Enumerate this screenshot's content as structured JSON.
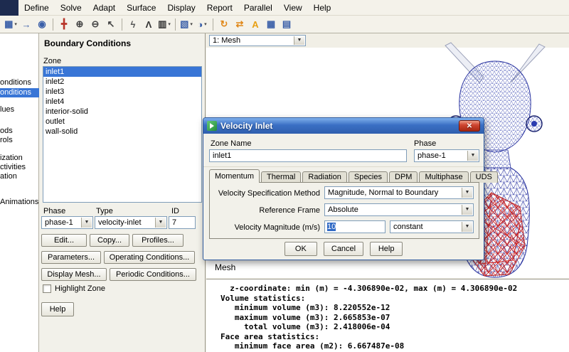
{
  "colors": {
    "selection_blue": "#3875d6",
    "titlebar_blue": "#3a6fc4",
    "close_button_red": "#cf4631",
    "mesh_blue": "#2a34a0",
    "mesh_red": "#cc2222"
  },
  "menubar": {
    "items": [
      "Define",
      "Solve",
      "Adapt",
      "Surface",
      "Display",
      "Report",
      "Parallel",
      "View",
      "Help"
    ]
  },
  "toolbar": {
    "icons": [
      {
        "name": "save-icon",
        "glyph": "▦",
        "color": "#3a5fa8"
      },
      {
        "name": "export-icon",
        "glyph": "→",
        "color": "#3a5fa8"
      },
      {
        "name": "snapshot-icon",
        "glyph": "◉",
        "color": "#3a5fa8"
      },
      {
        "name": "pan-icon",
        "glyph": "╋",
        "color": "#b8352a"
      },
      {
        "name": "zoom-in-icon",
        "glyph": "⊕",
        "color": "#444444"
      },
      {
        "name": "zoom-out-icon",
        "glyph": "⊖",
        "color": "#444444"
      },
      {
        "name": "pick-icon",
        "glyph": "↖",
        "color": "#444444"
      },
      {
        "name": "probe-icon",
        "glyph": "ϟ",
        "color": "#555555"
      },
      {
        "name": "profile-icon",
        "glyph": "Λ",
        "color": "#333333"
      },
      {
        "name": "ruler-icon",
        "glyph": "▥",
        "color": "#333333"
      },
      {
        "name": "scene-icon",
        "glyph": "▧",
        "color": "#3a5fa8"
      },
      {
        "name": "lights-icon",
        "glyph": "◑",
        "color": "#3a5fa8"
      },
      {
        "name": "refresh-icon",
        "glyph": "↻",
        "color": "#e0881a"
      },
      {
        "name": "sync-icon",
        "glyph": "⇄",
        "color": "#e0881a"
      },
      {
        "name": "annotate-icon",
        "glyph": "A",
        "color": "#e8a013"
      },
      {
        "name": "grid-icon",
        "glyph": "▦",
        "color": "#3a5fa8"
      },
      {
        "name": "layout-icon",
        "glyph": "▤",
        "color": "#3a5fa8"
      }
    ]
  },
  "nav_tree": {
    "items": [
      {
        "label": "onditions",
        "selected": false
      },
      {
        "label": "onditions",
        "selected": true
      },
      {
        "label": "lues",
        "selected": false
      },
      {
        "label": "ods",
        "selected": false
      },
      {
        "label": "rols",
        "selected": false
      },
      {
        "label": "ization",
        "selected": false
      },
      {
        "label": "ctivities",
        "selected": false
      },
      {
        "label": "ation",
        "selected": false
      },
      {
        "label": "Animations",
        "selected": false
      }
    ]
  },
  "bc_panel": {
    "title": "Boundary Conditions",
    "zone_label": "Zone",
    "zones": [
      "inlet1",
      "inlet2",
      "inlet3",
      "inlet4",
      "interior-solid",
      "outlet",
      "wall-solid"
    ],
    "selected_zone": "inlet1",
    "phase_label": "Phase",
    "phase_value": "phase-1",
    "type_label": "Type",
    "type_value": "velocity-inlet",
    "id_label": "ID",
    "id_value": "7",
    "buttons": {
      "edit": "Edit...",
      "copy": "Copy...",
      "profiles": "Profiles...",
      "parameters": "Parameters...",
      "operating_conditions": "Operating Conditions...",
      "display_mesh": "Display Mesh...",
      "periodic_conditions": "Periodic Conditions...",
      "help": "Help"
    },
    "highlight_zone_label": "Highlight Zone"
  },
  "graphics": {
    "view_selector": "1: Mesh",
    "caption": "Mesh"
  },
  "console": {
    "lines": [
      "  z-coordinate: min (m) = -4.306890e-02, max (m) = 4.306890e-02",
      "Volume statistics:",
      "   minimum volume (m3): 8.220552e-12",
      "   maximum volume (m3): 2.665853e-07",
      "     total volume (m3): 2.418006e-04",
      "Face area statistics:",
      "   minimum face area (m2): 6.667487e-08"
    ]
  },
  "dialog": {
    "title": "Velocity Inlet",
    "zone_name_label": "Zone Name",
    "zone_name_value": "inlet1",
    "phase_label": "Phase",
    "phase_value": "phase-1",
    "tabs": [
      "Momentum",
      "Thermal",
      "Radiation",
      "Species",
      "DPM",
      "Multiphase",
      "UDS"
    ],
    "active_tab": "Momentum",
    "momentum": {
      "velocity_spec_label": "Velocity Specification Method",
      "velocity_spec_value": "Magnitude, Normal to Boundary",
      "reference_frame_label": "Reference Frame",
      "reference_frame_value": "Absolute",
      "velocity_magnitude_label": "Velocity Magnitude (m/s)",
      "velocity_magnitude_value": "10",
      "velocity_magnitude_profile": "constant"
    },
    "buttons": {
      "ok": "OK",
      "cancel": "Cancel",
      "help": "Help"
    }
  }
}
